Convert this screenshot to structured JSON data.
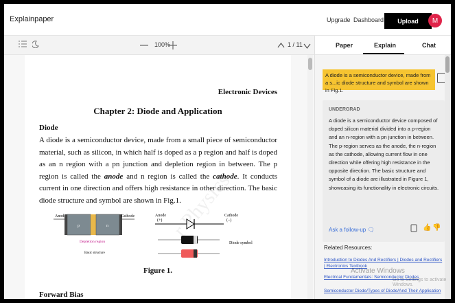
{
  "app": {
    "title": "Explainpaper"
  },
  "topnav": {
    "upgrade": "Upgrade",
    "dashboard": "Dashboard",
    "upload": "Upload",
    "avatar_initial": "M"
  },
  "toolbar": {
    "zoom": "100%",
    "page_indicator": "1 / 11",
    "minus": "—",
    "plus": "+"
  },
  "document": {
    "header": "Electronic Devices",
    "chapter": "Chapter 2: Diode and Application",
    "section": "Diode",
    "body_parts": [
      "A diode is a semiconductor device, made from a small piece of semiconductor material, such as silicon, in which half is doped as a p region and half is doped as an n region with a pn junction and depletion region in between. The p region is called the ",
      "anode",
      " and n region is called the ",
      "cathode",
      ". It conducts current in one direction and offers high resistance in other direction. The basic diode structure and symbol are shown in Fig.1."
    ],
    "figure": {
      "anode": "Anode",
      "cathode": "Cathode",
      "p": "p",
      "n": "n",
      "depletion": "Depletion region",
      "basic": "Basic structure",
      "sym_anode": "Anode",
      "sym_anode_sign": "(+)",
      "sym_cathode": "Cathode",
      "sym_cathode_sign": "(−)",
      "diode_symbol": "Diode symbol",
      "caption": "Figure 1."
    },
    "next_section": "Forward Bias",
    "watermark": "r Physics"
  },
  "panel": {
    "tabs": [
      "Paper",
      "Explain",
      "Chat"
    ],
    "highlight": "A diode is a semiconductor device, made from a s...ic diode structure and symbol are shown in Fig.1.",
    "level": "UNDERGRAD",
    "explanation": "A diode is a semiconductor device composed of doped silicon material divided into a p-region and an n-region with a pn junction in between. The p-region serves as the anode, the n-region as the cathode, allowing current flow in one direction while offering high resistance in the opposite direction. The basic structure and symbol of a diode are illustrated in Figure 1, showcasing its functionality in electronic circuits.",
    "follow_up": "Ask a follow-up",
    "related_title": "Related Resources:",
    "related": [
      "Introduction to Diodes And Rectifiers | Diodes and Rectifiers | Electronics Textbook",
      "Electrical Fundamentals: Semiconductor Diodes",
      "Semiconductor Diode/Types of Diode/And Their Application"
    ]
  },
  "os_overlay": {
    "line1": "Activate Windows",
    "line2": "Go to Settings to activate Windows."
  }
}
